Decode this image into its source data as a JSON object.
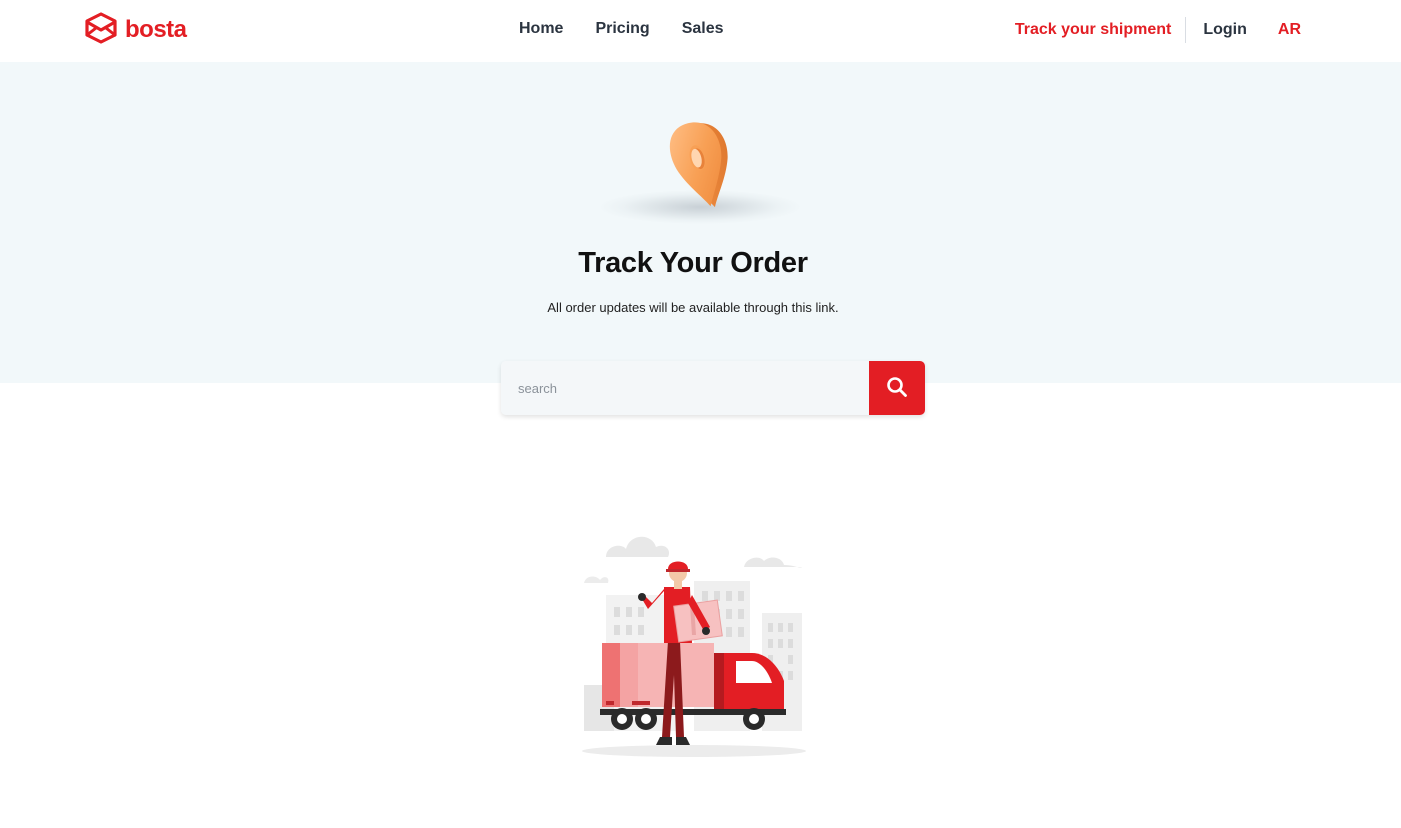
{
  "header": {
    "logo_text": "bosta",
    "nav": {
      "home": "Home",
      "pricing": "Pricing",
      "sales": "Sales"
    },
    "track_link": "Track your shipment",
    "login": "Login",
    "language": "AR"
  },
  "hero": {
    "title": "Track Your Order",
    "subtitle": "All order updates will be available through this link."
  },
  "search": {
    "placeholder": "search"
  },
  "colors": {
    "brand": "#e31e24",
    "hero_background": "#f2f8fa",
    "pin": "#f8a055"
  }
}
